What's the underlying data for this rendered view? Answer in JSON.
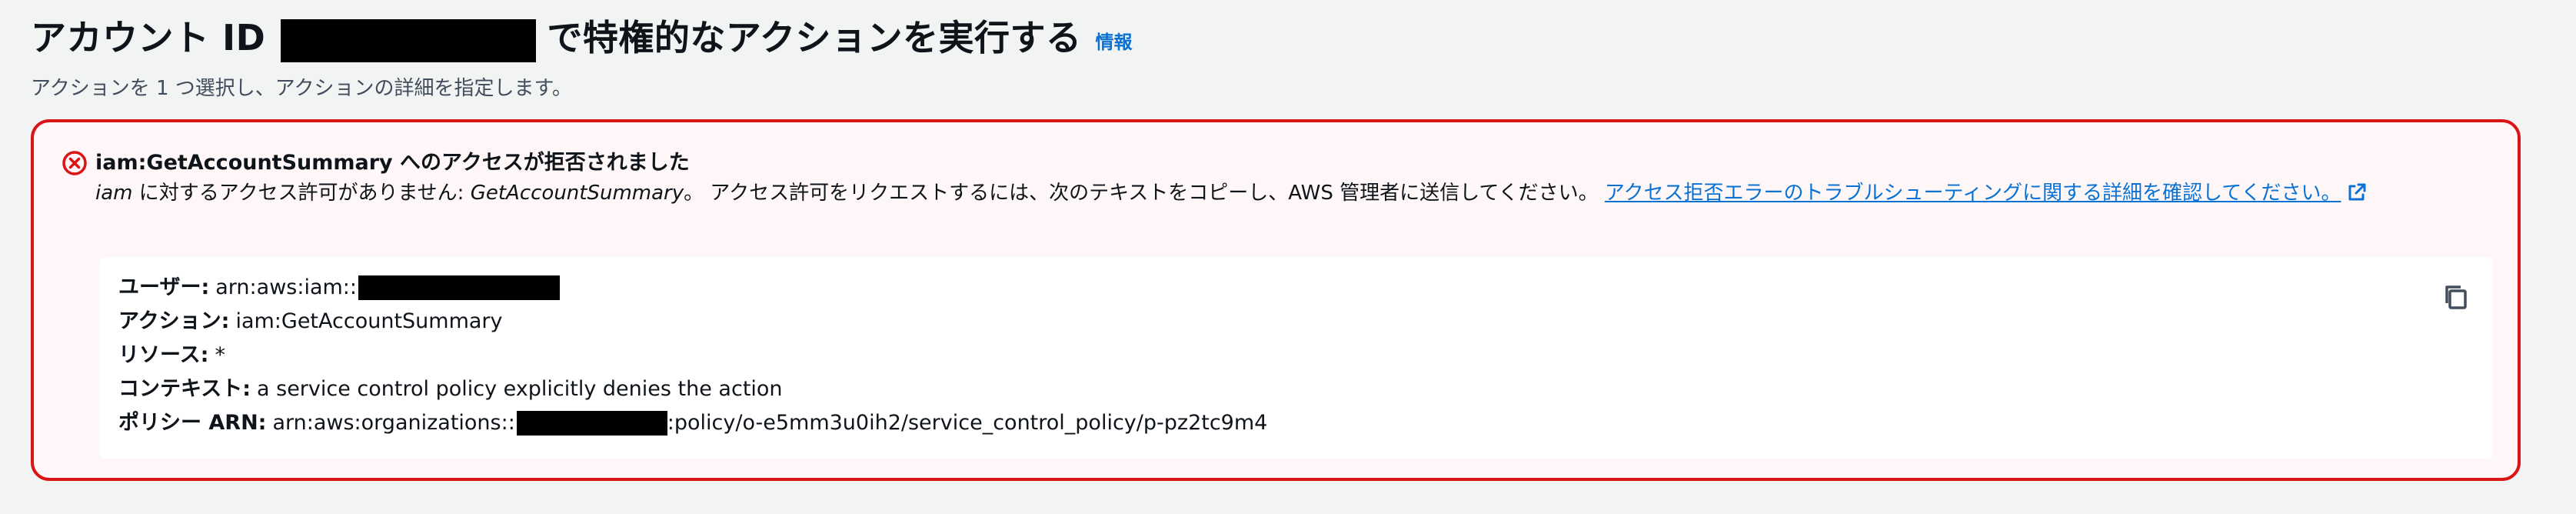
{
  "header": {
    "title_prefix": "アカウント ID",
    "title_suffix": "で特権的なアクションを実行する",
    "info_link": "情報",
    "subtitle": "アクションを 1 つ選択し、アクションの詳細を指定します。"
  },
  "alert": {
    "type": "error",
    "title": "iam:GetAccountSummary へのアクセスが拒否されました",
    "message_subject": "iam",
    "message_part1": " に対するアクセス許可がありません: ",
    "message_action": "GetAccountSummary",
    "message_part2": "。 アクセス許可をリクエストするには、次のテキストをコピーし、AWS 管理者に送信してください。 ",
    "link_text": "アクセス拒否エラーのトラブルシューティングに関する詳細を確認してください。",
    "details": {
      "user_label": "ユーザー:",
      "user_value": "arn:aws:iam::",
      "action_label": "アクション:",
      "action_value": "iam:GetAccountSummary",
      "resource_label": "リソース:",
      "resource_value": "*",
      "context_label": "コンテキスト:",
      "context_value": "a service control policy explicitly denies the action",
      "policy_label": "ポリシー ARN:",
      "policy_value_prefix": "arn:aws:organizations::",
      "policy_value_suffix": ":policy/o-e5mm3u0ih2/service_control_policy/p-pz2tc9m4"
    }
  },
  "icons": {
    "error": "error-circle-icon",
    "external": "external-link-icon",
    "copy": "copy-icon"
  },
  "colors": {
    "error_red": "#d91515",
    "link_blue": "#0972d3",
    "alert_bg": "#fff7f7"
  }
}
